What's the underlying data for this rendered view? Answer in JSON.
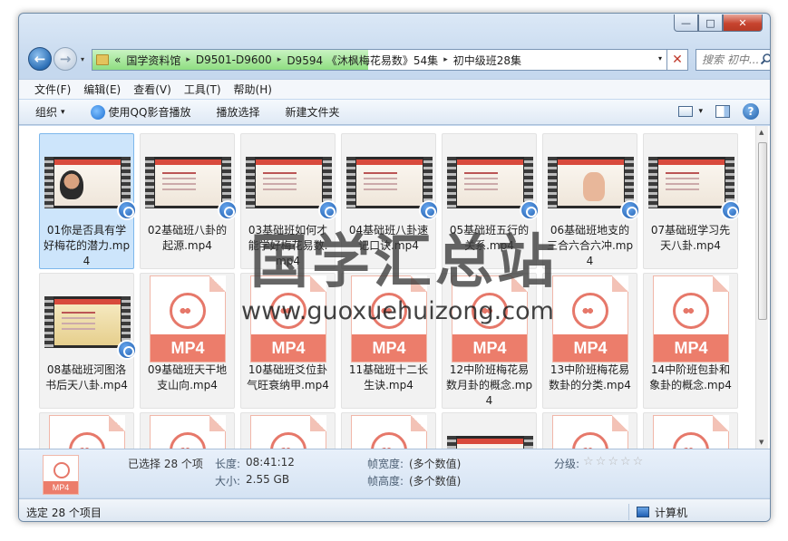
{
  "window": {
    "caption": {
      "minimize": "—",
      "maximize": "□",
      "close": "✕"
    }
  },
  "nav": {
    "back_icon": "←",
    "forward_icon": "→",
    "dropdown_icon": "▾",
    "breadcrumb_prefix": "«",
    "breadcrumbs": [
      "国学资料馆",
      "D9501-D9600",
      "D9594 《沐枫梅花易数》54集",
      "初中级班28集"
    ],
    "separator": "▸",
    "address_dropdown": "▾",
    "refresh_icon": "✕",
    "search_placeholder": "搜索 初中...",
    "search_icon": "search-icon"
  },
  "menu": {
    "items": [
      "文件(F)",
      "编辑(E)",
      "查看(V)",
      "工具(T)",
      "帮助(H)"
    ]
  },
  "toolbar": {
    "organize": "组织",
    "organize_arrow": "▾",
    "play_qq": "使用QQ影音播放",
    "play_selection": "播放选择",
    "new_folder": "新建文件夹",
    "view_arrow": "▾",
    "help": "?"
  },
  "files": [
    {
      "name": "01你是否具有学好梅花的潜力.mp4",
      "thumb": "video",
      "style": "face"
    },
    {
      "name": "02基础班八卦的起源.mp4",
      "thumb": "video",
      "style": "slide"
    },
    {
      "name": "03基础班如何才能学好梅花易数.mp4",
      "thumb": "video",
      "style": "slide"
    },
    {
      "name": "04基础班八卦速记口诀.mp4",
      "thumb": "video",
      "style": "slide"
    },
    {
      "name": "05基础班五行的关系.mp4",
      "thumb": "video",
      "style": "slide"
    },
    {
      "name": "06基础班地支的三合六合六冲.mp4",
      "thumb": "video",
      "style": "hand"
    },
    {
      "name": "07基础班学习先天八卦.mp4",
      "thumb": "video",
      "style": "slide"
    },
    {
      "name": "08基础班河图洛书后天八卦.mp4",
      "thumb": "video",
      "style": "gold"
    },
    {
      "name": "09基础班天干地支山向.mp4",
      "thumb": "mp4"
    },
    {
      "name": "10基础班爻位卦气旺衰纳甲.mp4",
      "thumb": "mp4"
    },
    {
      "name": "11基础班十二长生诀.mp4",
      "thumb": "mp4"
    },
    {
      "name": "12中阶班梅花易数月卦的概念.mp4",
      "thumb": "mp4"
    },
    {
      "name": "13中阶班梅花易数卦的分类.mp4",
      "thumb": "mp4"
    },
    {
      "name": "14中阶班包卦和象卦的概念.mp4",
      "thumb": "mp4"
    },
    {
      "name": "",
      "thumb": "mp4"
    },
    {
      "name": "",
      "thumb": "mp4"
    },
    {
      "name": "",
      "thumb": "mp4"
    },
    {
      "name": "",
      "thumb": "mp4"
    },
    {
      "name": "",
      "thumb": "video",
      "style": "slide"
    },
    {
      "name": "",
      "thumb": "mp4"
    },
    {
      "name": "",
      "thumb": "mp4"
    }
  ],
  "mp4_label": "MP4",
  "watermark": {
    "title": "国学汇总站",
    "url": "www.guoxuehuizong.com"
  },
  "details": {
    "icon_label": "MP4",
    "selected": "已选择 28 个项",
    "length_key": "长度:",
    "length_val": "08:41:12",
    "size_key": "大小:",
    "size_val": "2.55 GB",
    "frame_width_key": "帧宽度:",
    "frame_width_val": "(多个数值)",
    "frame_height_key": "帧高度:",
    "frame_height_val": "(多个数值)",
    "rating_key": "分级:",
    "stars": [
      "☆",
      "☆",
      "☆",
      "☆",
      "☆"
    ]
  },
  "status": {
    "left": "选定 28 个项目",
    "right": "计算机"
  },
  "scroll": {
    "up": "▲",
    "down": "▼"
  },
  "colors": {
    "accent": "#1f5ea8",
    "mp4": "#ec7d6b",
    "selection": "#cde5fb"
  }
}
